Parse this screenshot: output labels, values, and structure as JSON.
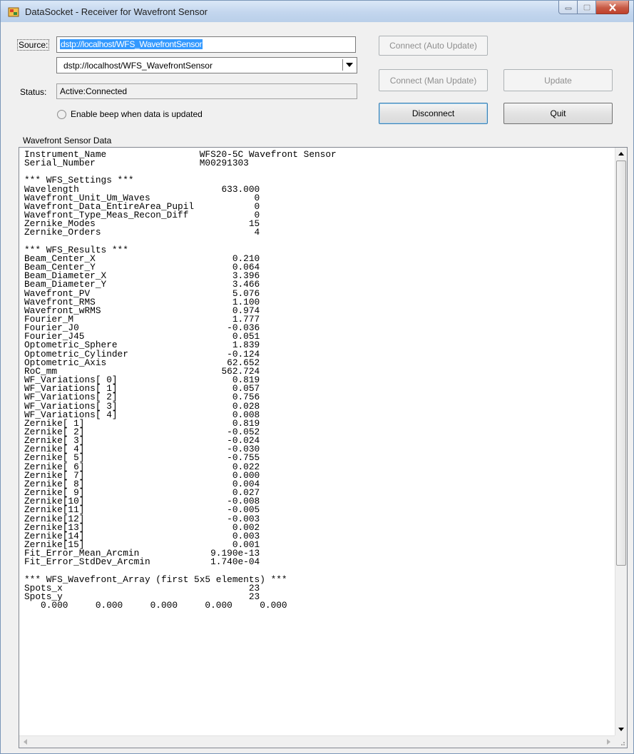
{
  "window": {
    "title": "DataSocket - Receiver for Wavefront Sensor"
  },
  "source": {
    "label": "Source:",
    "value": "dstp://localhost/WFS_WavefrontSensor",
    "combo_value": "dstp://localhost/WFS_WavefrontSensor"
  },
  "status": {
    "label": "Status:",
    "value": "Active:Connected"
  },
  "beep_option": {
    "label": "Enable beep when data is updated",
    "checked": false
  },
  "buttons": {
    "connect_auto": "Connect (Auto Update)",
    "connect_man": "Connect (Man Update)",
    "update": "Update",
    "disconnect": "Disconnect",
    "quit": "Quit"
  },
  "data_section": {
    "label": "Wavefront Sensor Data",
    "lines": [
      "Instrument_Name                 WFS20-5C Wavefront Sensor",
      "Serial_Number                   M00291303",
      "",
      "*** WFS_Settings ***",
      "Wavelength                          633.000",
      "Wavefront_Unit_Um_Waves                   0",
      "Wavefront_Data_EntireArea_Pupil           0",
      "Wavefront_Type_Meas_Recon_Diff            0",
      "Zernike_Modes                            15",
      "Zernike_Orders                            4",
      "",
      "*** WFS_Results ***",
      "Beam_Center_X                         0.210",
      "Beam_Center_Y                         0.064",
      "Beam_Diameter_X                       3.396",
      "Beam_Diameter_Y                       3.466",
      "Wavefront_PV                          5.076",
      "Wavefront_RMS                         1.100",
      "Wavefront_wRMS                        0.974",
      "Fourier_M                             1.777",
      "Fourier_J0                           -0.036",
      "Fourier_J45                           0.051",
      "Optometric_Sphere                     1.839",
      "Optometric_Cylinder                  -0.124",
      "Optometric_Axis                      62.652",
      "RoC_mm                              562.724",
      "WF_Variations[ 0]                     0.819",
      "WF_Variations[ 1]                     0.057",
      "WF_Variations[ 2]                     0.756",
      "WF_Variations[ 3]                     0.028",
      "WF_Variations[ 4]                     0.008",
      "Zernike[ 1]                           0.819",
      "Zernike[ 2]                          -0.052",
      "Zernike[ 3]                          -0.024",
      "Zernike[ 4]                          -0.030",
      "Zernike[ 5]                          -0.755",
      "Zernike[ 6]                           0.022",
      "Zernike[ 7]                           0.000",
      "Zernike[ 8]                           0.004",
      "Zernike[ 9]                           0.027",
      "Zernike[10]                          -0.008",
      "Zernike[11]                          -0.005",
      "Zernike[12]                          -0.003",
      "Zernike[13]                           0.002",
      "Zernike[14]                           0.003",
      "Zernike[15]                           0.001",
      "Fit_Error_Mean_Arcmin             9.190e-13",
      "Fit_Error_StdDev_Arcmin           1.740e-04",
      "",
      "*** WFS_Wavefront_Array (first 5x5 elements) ***",
      "Spots_x                                  23",
      "Spots_y                                  23",
      "   0.000     0.000     0.000     0.000     0.000"
    ]
  }
}
